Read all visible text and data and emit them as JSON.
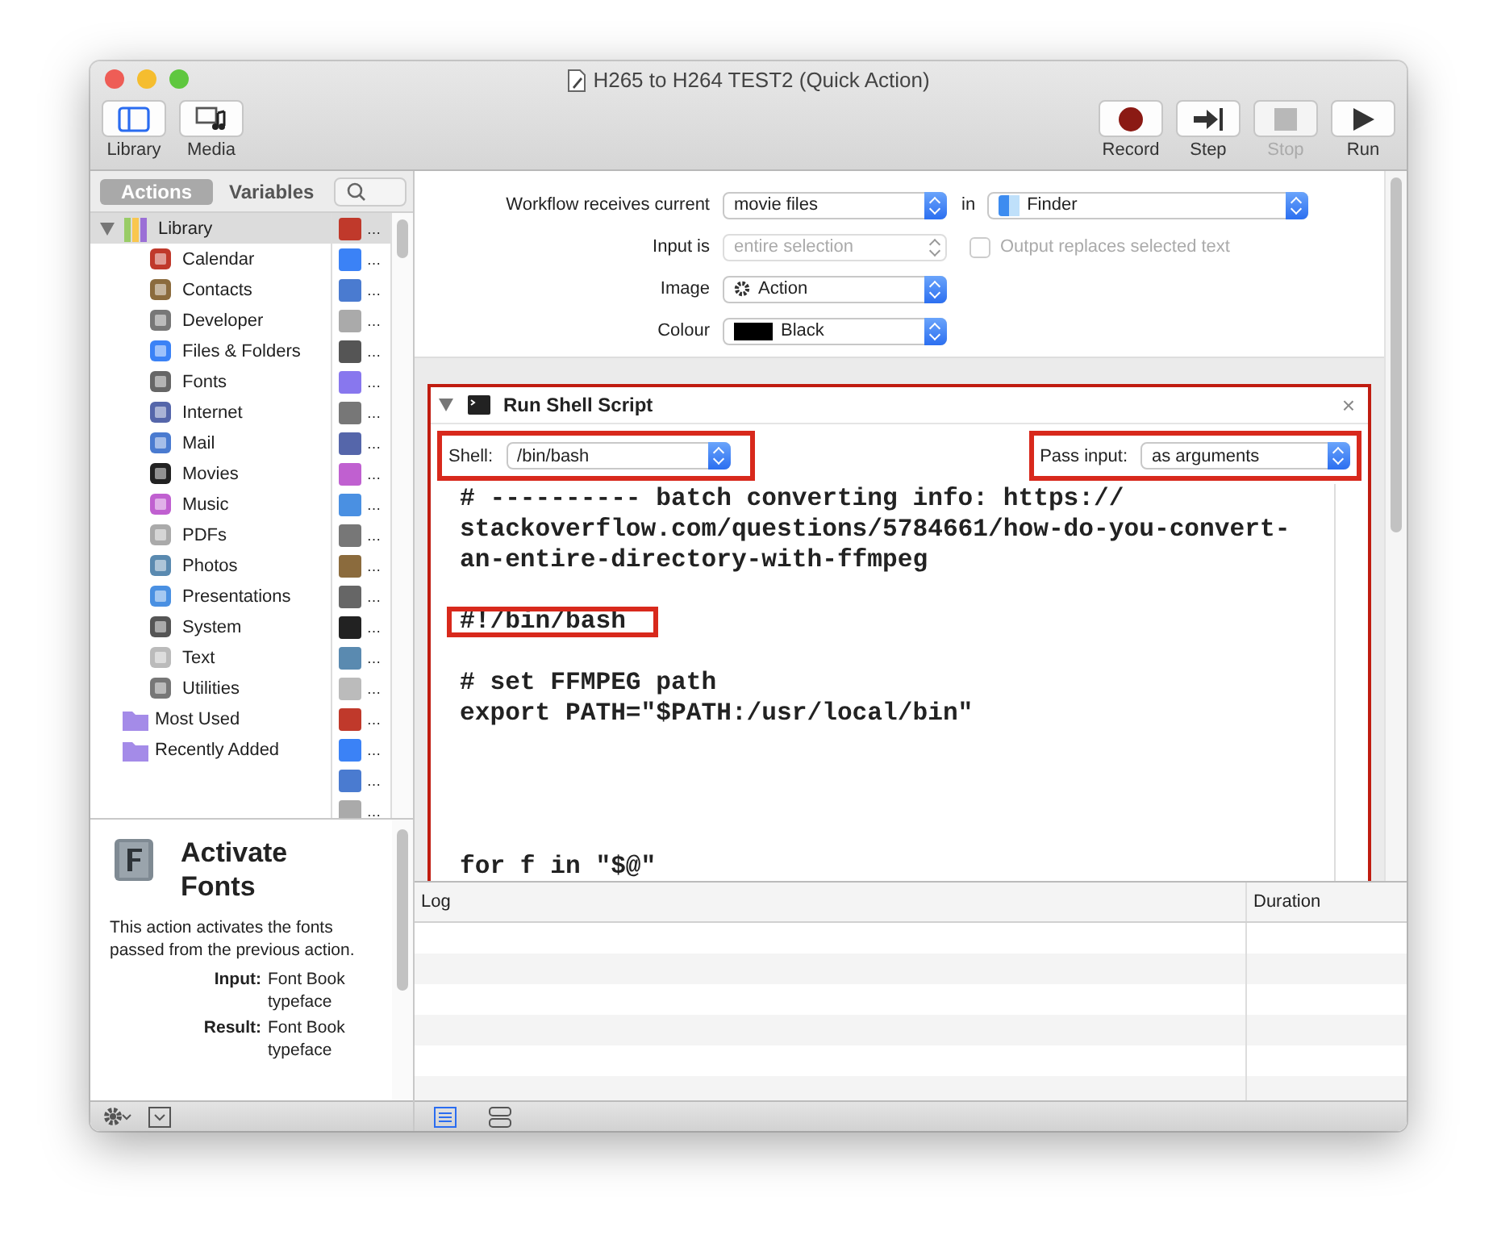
{
  "window": {
    "title": "H265 to H264 TEST2 (Quick Action)"
  },
  "toolbar_left": [
    {
      "label": "Library",
      "selected": true
    },
    {
      "label": "Media",
      "selected": false
    }
  ],
  "toolbar_right": [
    {
      "kind": "record",
      "label": "Record",
      "disabled": false
    },
    {
      "kind": "step",
      "label": "Step",
      "disabled": false
    },
    {
      "kind": "stop",
      "label": "Stop",
      "disabled": true
    },
    {
      "kind": "run",
      "label": "Run",
      "disabled": false
    }
  ],
  "sidebar": {
    "tabs": [
      {
        "label": "Actions",
        "selected": true
      },
      {
        "label": "Variables",
        "selected": false
      }
    ],
    "tree": [
      {
        "label": "Library",
        "expanded": true,
        "selected": true,
        "children": [
          {
            "label": "Calendar"
          },
          {
            "label": "Contacts"
          },
          {
            "label": "Developer"
          },
          {
            "label": "Files & Folders"
          },
          {
            "label": "Fonts"
          },
          {
            "label": "Internet"
          },
          {
            "label": "Mail"
          },
          {
            "label": "Movies"
          },
          {
            "label": "Music"
          },
          {
            "label": "PDFs"
          },
          {
            "label": "Photos"
          },
          {
            "label": "Presentations"
          },
          {
            "label": "System"
          },
          {
            "label": "Text"
          },
          {
            "label": "Utilities"
          }
        ]
      },
      {
        "label": "Most Used",
        "selected": false
      },
      {
        "label": "Recently Added",
        "selected": false
      }
    ],
    "actions": [
      "…",
      "…",
      "…",
      "…",
      "…",
      "…",
      "…",
      "…",
      "…",
      "…",
      "…",
      "…",
      "…",
      "…",
      "…",
      "…",
      "…",
      "…",
      "…",
      "…"
    ],
    "description": {
      "title": "Activate Fonts",
      "text": "This action activates the fonts passed from the previous action.",
      "fields": [
        {
          "label": "Input:",
          "value": "Font Book typeface"
        },
        {
          "label": "Result:",
          "value": "Font Book typeface"
        }
      ]
    }
  },
  "workflow": {
    "receives_label": "Workflow receives current",
    "receives": "movie files",
    "in_label": "in",
    "application": "Finder",
    "input_is_label": "Input is",
    "input_is": "entire selection",
    "input_is_disabled": true,
    "output_replaces": {
      "label": "Output replaces selected text",
      "checked": false,
      "disabled": true
    },
    "image_label": "Image",
    "image": "Action",
    "colour_label": "Colour",
    "colour": "Black"
  },
  "action": {
    "title": "Run Shell Script",
    "expanded": true,
    "highlighted": true,
    "close": "×",
    "shell": {
      "label": "Shell:",
      "value": "/bin/bash",
      "highlighted": true
    },
    "pass_input": {
      "label": "Pass input:",
      "value": "as arguments",
      "highlighted": true
    },
    "code_lines": [
      {
        "kind": "text",
        "text": "# ---------- batch converting info: https://",
        "highlighted": false
      },
      {
        "kind": "text",
        "text": "stackoverflow.com/questions/5784661/how-do-you-convert-",
        "highlighted": false
      },
      {
        "kind": "text",
        "text": "an-entire-directory-with-ffmpeg",
        "highlighted": false
      },
      {
        "kind": "blank"
      },
      {
        "kind": "text",
        "text": "#!/bin/bash",
        "highlighted": true
      },
      {
        "kind": "blank"
      },
      {
        "kind": "text",
        "text": "# set FFMPEG path",
        "highlighted": false
      },
      {
        "kind": "text",
        "text": "export PATH=\"$PATH:/usr/local/bin\"",
        "highlighted": false
      },
      {
        "kind": "blank"
      },
      {
        "kind": "blank"
      },
      {
        "kind": "blank"
      },
      {
        "kind": "blank"
      },
      {
        "kind": "text",
        "text": "for f in \"$@\"",
        "highlighted": false
      }
    ]
  },
  "log": {
    "columns": [
      "Log",
      "Duration"
    ]
  }
}
